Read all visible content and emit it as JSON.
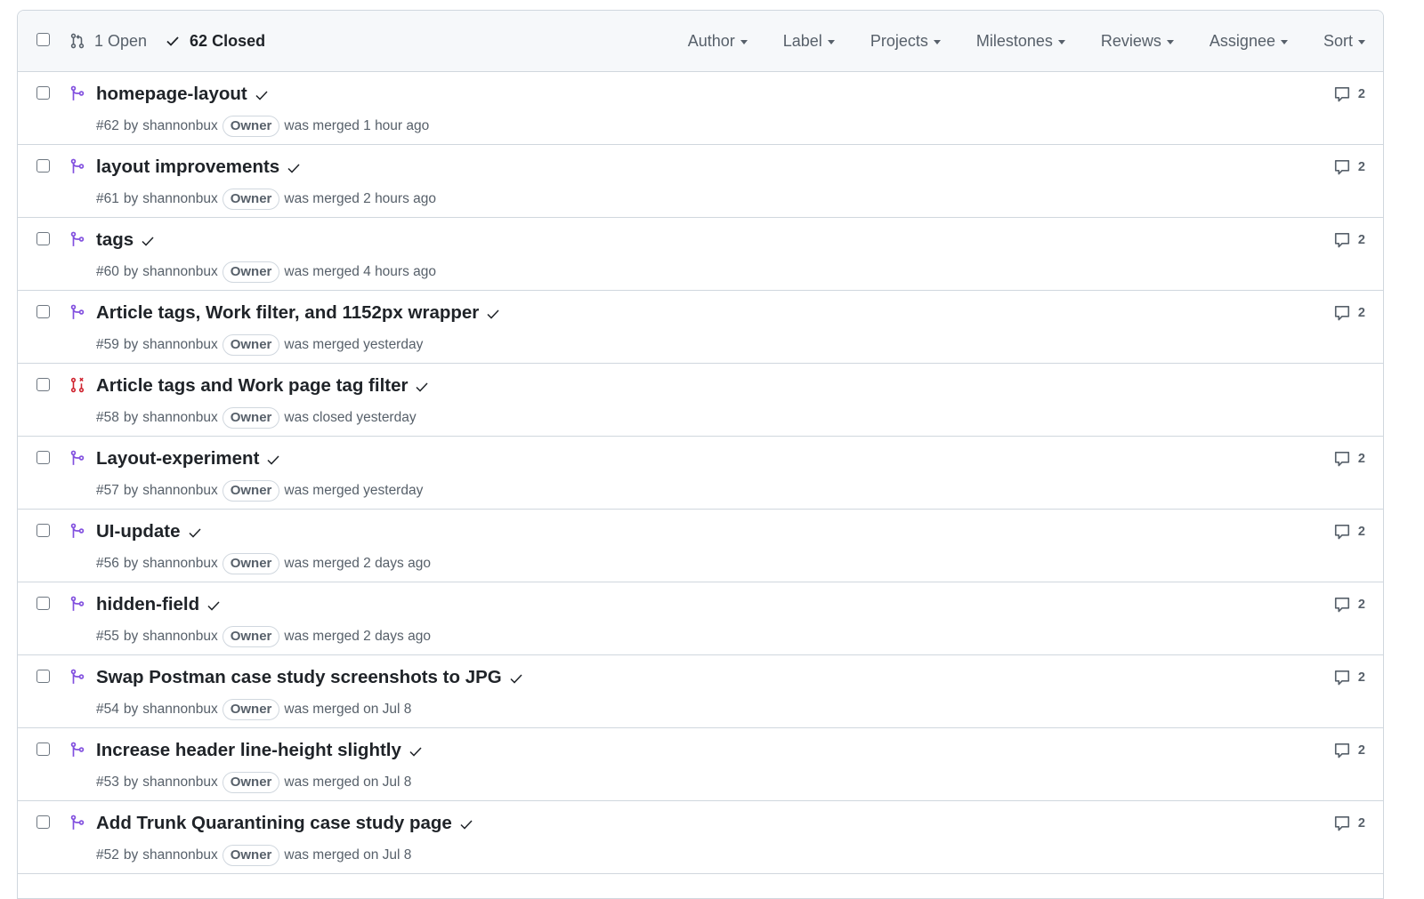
{
  "header": {
    "open_label": "1 Open",
    "closed_label": "62 Closed",
    "filters": [
      "Author",
      "Label",
      "Projects",
      "Milestones",
      "Reviews",
      "Assignee",
      "Sort"
    ]
  },
  "colors": {
    "merged": "#8250df",
    "closed": "#cf222e",
    "border": "#d0d7de",
    "muted": "#57606a"
  },
  "pulls": [
    {
      "title": "homepage-layout",
      "number": "#62",
      "by": "by",
      "author": "shannonbux",
      "badge": "Owner",
      "status": "was merged 1 hour ago",
      "state": "merged",
      "comments": "2"
    },
    {
      "title": "layout improvements",
      "number": "#61",
      "by": "by",
      "author": "shannonbux",
      "badge": "Owner",
      "status": "was merged 2 hours ago",
      "state": "merged",
      "comments": "2"
    },
    {
      "title": "tags",
      "number": "#60",
      "by": "by",
      "author": "shannonbux",
      "badge": "Owner",
      "status": "was merged 4 hours ago",
      "state": "merged",
      "comments": "2"
    },
    {
      "title": "Article tags, Work filter, and 1152px wrapper",
      "number": "#59",
      "by": "by",
      "author": "shannonbux",
      "badge": "Owner",
      "status": "was merged yesterday",
      "state": "merged",
      "comments": "2"
    },
    {
      "title": "Article tags and Work page tag filter",
      "number": "#58",
      "by": "by",
      "author": "shannonbux",
      "badge": "Owner",
      "status": "was closed yesterday",
      "state": "closed",
      "comments": ""
    },
    {
      "title": "Layout-experiment",
      "number": "#57",
      "by": "by",
      "author": "shannonbux",
      "badge": "Owner",
      "status": "was merged yesterday",
      "state": "merged",
      "comments": "2"
    },
    {
      "title": "UI-update",
      "number": "#56",
      "by": "by",
      "author": "shannonbux",
      "badge": "Owner",
      "status": "was merged 2 days ago",
      "state": "merged",
      "comments": "2"
    },
    {
      "title": "hidden-field",
      "number": "#55",
      "by": "by",
      "author": "shannonbux",
      "badge": "Owner",
      "status": "was merged 2 days ago",
      "state": "merged",
      "comments": "2"
    },
    {
      "title": "Swap Postman case study screenshots to JPG",
      "number": "#54",
      "by": "by",
      "author": "shannonbux",
      "badge": "Owner",
      "status": "was merged on Jul 8",
      "state": "merged",
      "comments": "2"
    },
    {
      "title": "Increase header line-height slightly",
      "number": "#53",
      "by": "by",
      "author": "shannonbux",
      "badge": "Owner",
      "status": "was merged on Jul 8",
      "state": "merged",
      "comments": "2"
    },
    {
      "title": "Add Trunk Quarantining case study page",
      "number": "#52",
      "by": "by",
      "author": "shannonbux",
      "badge": "Owner",
      "status": "was merged on Jul 8",
      "state": "merged",
      "comments": "2"
    }
  ]
}
